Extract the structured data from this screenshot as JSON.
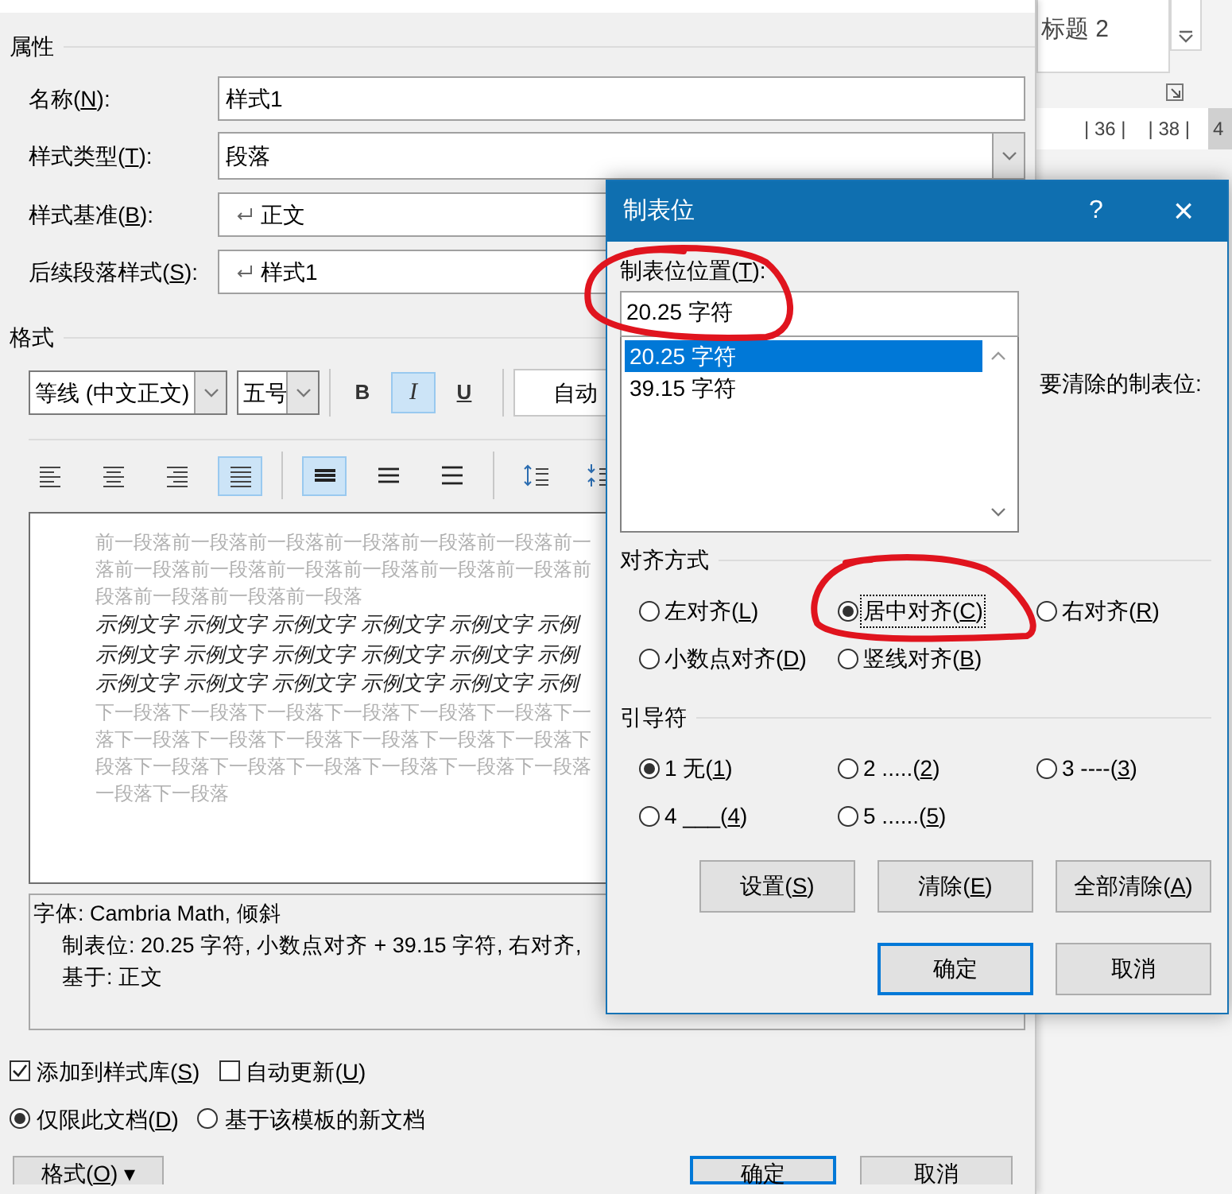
{
  "background": {
    "style_gallery": "标题 2",
    "ruler": [
      "| 36 |",
      "| 38 |",
      "4"
    ]
  },
  "main_dialog": {
    "properties_header": "属性",
    "fields": [
      {
        "label": "名称(N):",
        "kind": "text",
        "value": "样式1"
      },
      {
        "label": "样式类型(T):",
        "kind": "dropdown",
        "value": "段落"
      },
      {
        "label": "样式基准(B):",
        "kind": "style",
        "value": "正文"
      },
      {
        "label": "后续段落样式(S):",
        "kind": "style",
        "value": "样式1"
      }
    ],
    "format_header": "格式",
    "font": "等线 (中文正文)",
    "size": "五号",
    "font_buttons": [
      {
        "label": "B",
        "kind": "bold",
        "selected": false
      },
      {
        "label": "I",
        "kind": "italic",
        "selected": true
      },
      {
        "label": "U",
        "kind": "underline",
        "selected": false
      }
    ],
    "color_setting": "自动",
    "paragraph_buttons": [
      {
        "kind": "align-left",
        "selected": false
      },
      {
        "kind": "align-center",
        "selected": false
      },
      {
        "kind": "align-right",
        "selected": false
      },
      {
        "kind": "justify",
        "selected": true
      },
      {
        "kind": "single-spacing",
        "selected": true
      },
      {
        "kind": "one-half-spacing",
        "selected": false
      },
      {
        "kind": "double-spacing",
        "selected": false
      },
      {
        "kind": "space-before",
        "selected": false
      },
      {
        "kind": "space-after",
        "selected": false
      }
    ],
    "preview": {
      "previous": [
        "前一段落前一段落前一段落前一段落前一段落前一段落前一",
        "落前一段落前一段落前一段落前一段落前一段落前一段落前",
        "段落前一段落前一段落前一段落"
      ],
      "sample": [
        "示例文字 示例文字 示例文字 示例文字 示例文字 示例",
        "示例文字 示例文字 示例文字 示例文字 示例文字 示例",
        "示例文字 示例文字 示例文字 示例文字 示例文字 示例"
      ],
      "next": [
        "下一段落下一段落下一段落下一段落下一段落下一段落下一",
        "落下一段落下一段落下一段落下一段落下一段落下一段落下",
        "段落下一段落下一段落下一段落下一段落下一段落下一段落",
        "一段落下一段落"
      ]
    },
    "description": [
      "字体: Cambria Math, 倾斜",
      "制表位:  20.25 字符, 小数点对齐 +  39.15 字符, 右对齐,",
      "基于: 正文"
    ],
    "options": [
      {
        "label": "添加到样式库(S)",
        "checked": true
      },
      {
        "label": "自动更新(U)",
        "checked": false
      }
    ],
    "scope": [
      {
        "label": "仅限此文档(D)",
        "selected": true
      },
      {
        "label": "基于该模板的新文档",
        "selected": false
      }
    ],
    "buttons": [
      {
        "label": "格式(O) ▾",
        "kind": "menu"
      },
      {
        "label": "确定",
        "kind": "default"
      },
      {
        "label": "取消",
        "kind": "normal"
      }
    ]
  },
  "tab_dialog": {
    "title": "制表位",
    "help": "?",
    "close": "×",
    "position_label": "制表位位置(T):",
    "position_value": "20.25 字符",
    "tab_stops": [
      {
        "label": "20.25 字符",
        "selected": true
      },
      {
        "label": "39.15 字符",
        "selected": false
      }
    ],
    "clear_label": "要清除的制表位:",
    "alignment_header": "对齐方式",
    "alignment": [
      {
        "label": "左对齐(L)",
        "selected": false
      },
      {
        "label": "居中对齐(C)",
        "selected": true
      },
      {
        "label": "右对齐(R)",
        "selected": false
      },
      {
        "label": "小数点对齐(D)",
        "selected": false
      },
      {
        "label": "竖线对齐(B)",
        "selected": false
      }
    ],
    "leader_header": "引导符",
    "leaders": [
      {
        "label": "1 无(1)",
        "selected": true
      },
      {
        "label": "2 .....(2)",
        "selected": false
      },
      {
        "label": "3 ----(3)",
        "selected": false
      },
      {
        "label": "4 ___(4)",
        "selected": false
      },
      {
        "label": "5 ......(5)",
        "selected": false
      }
    ],
    "action_buttons": [
      "设置(S)",
      "清除(E)",
      "全部清除(A)"
    ],
    "buttons": [
      {
        "label": "确定",
        "kind": "default"
      },
      {
        "label": "取消",
        "kind": "normal"
      }
    ]
  }
}
